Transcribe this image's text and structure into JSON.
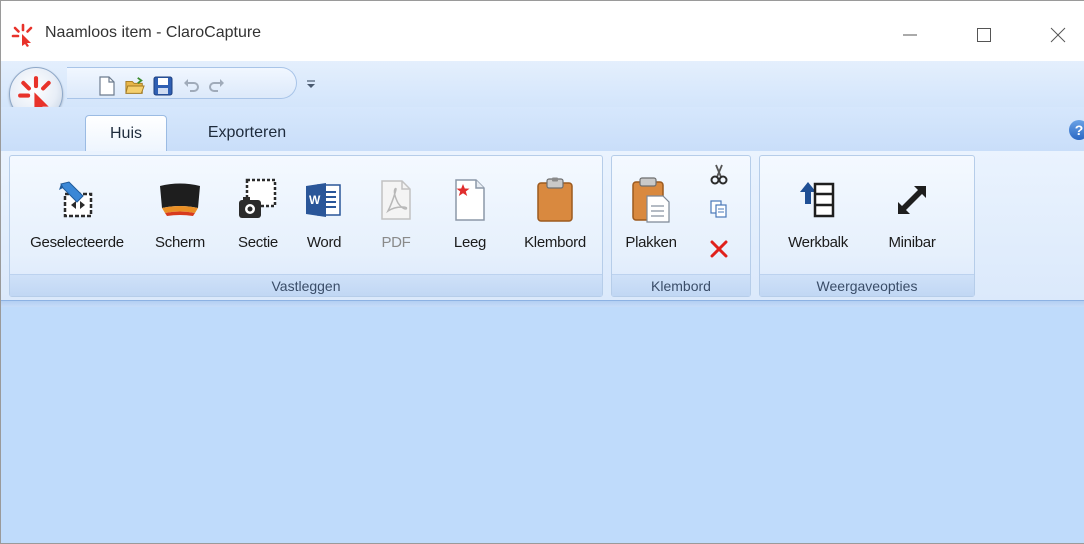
{
  "window": {
    "title": "Naamloos item - ClaroCapture",
    "controls": {
      "minimize": "minimize-icon",
      "maximize": "maximize-icon",
      "close": "close-icon"
    }
  },
  "quick_access": {
    "buttons": [
      "new-document-icon",
      "open-folder-icon",
      "save-icon",
      "undo-icon",
      "redo-icon"
    ],
    "customize": "customize-dropdown-icon"
  },
  "tabs": [
    {
      "label": "Huis",
      "active": true
    },
    {
      "label": "Exporteren",
      "active": false
    }
  ],
  "help_label": "?",
  "ribbon": {
    "groups": {
      "vastleggen": {
        "label": "Vastleggen",
        "buttons": [
          {
            "label": "Geselecteerde",
            "icon": "selected-area-icon"
          },
          {
            "label": "Scherm",
            "icon": "screen-icon"
          },
          {
            "label": "Sectie",
            "icon": "section-camera-icon"
          },
          {
            "label": "Word",
            "icon": "word-icon"
          },
          {
            "label": "PDF",
            "icon": "pdf-icon",
            "disabled": true
          },
          {
            "label": "Leeg",
            "icon": "blank-page-icon"
          },
          {
            "label": "Klembord",
            "icon": "clipboard-icon"
          }
        ]
      },
      "klembord": {
        "label": "Klembord",
        "buttons": [
          {
            "label": "Plakken",
            "icon": "paste-icon"
          }
        ],
        "small_buttons": [
          "cut-icon",
          "copy-icon",
          "delete-icon"
        ]
      },
      "weergaveopties": {
        "label": "Weergaveopties",
        "buttons": [
          {
            "label": "Werkbalk",
            "icon": "toolbar-icon"
          },
          {
            "label": "Minibar",
            "icon": "minibar-icon"
          }
        ]
      }
    }
  },
  "colors": {
    "workspace": "#bfdbfb",
    "accent_red": "#e8322a"
  }
}
